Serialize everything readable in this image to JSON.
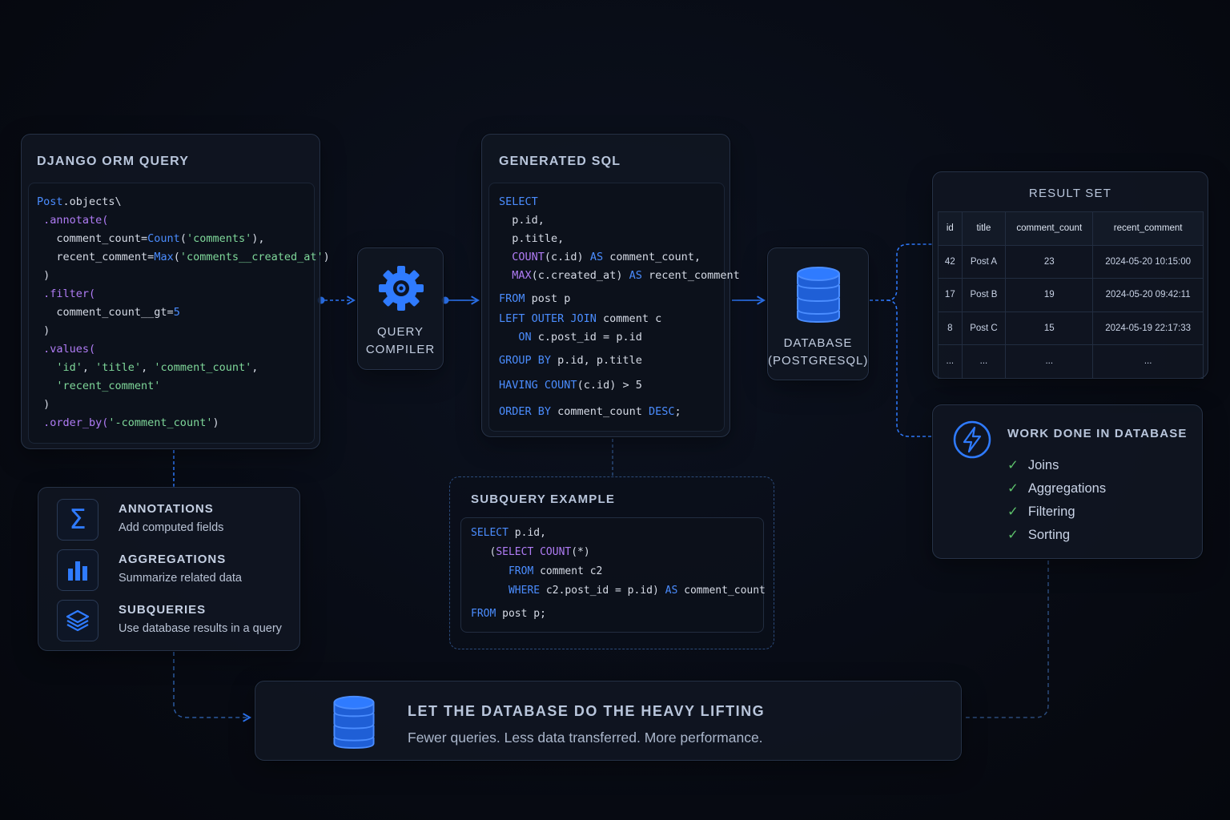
{
  "orm_panel": {
    "title": "DJANGO ORM QUERY",
    "lines": [
      [
        {
          "t": "Post",
          "c": "kw"
        },
        {
          "t": ".objects\\",
          "c": ""
        }
      ],
      [
        {
          "t": " .annotate(",
          "c": "fn"
        }
      ],
      [
        {
          "t": "   comment_count=",
          "c": ""
        },
        {
          "t": "Count",
          "c": "kw"
        },
        {
          "t": "(",
          "c": ""
        },
        {
          "t": "'comments'",
          "c": "str"
        },
        {
          "t": "),",
          "c": ""
        }
      ],
      [
        {
          "t": "   recent_comment=",
          "c": ""
        },
        {
          "t": "Max",
          "c": "kw"
        },
        {
          "t": "(",
          "c": ""
        },
        {
          "t": "'comments__created_at'",
          "c": "str"
        },
        {
          "t": ")",
          "c": ""
        }
      ],
      [
        {
          "t": " )",
          "c": ""
        }
      ],
      [
        {
          "t": " .filter(",
          "c": "fn"
        }
      ],
      [
        {
          "t": "   comment_count__gt=",
          "c": ""
        },
        {
          "t": "5",
          "c": "kw"
        }
      ],
      [
        {
          "t": " )",
          "c": ""
        }
      ],
      [
        {
          "t": " .values(",
          "c": "fn"
        }
      ],
      [
        {
          "t": "   ",
          "c": ""
        },
        {
          "t": "'id'",
          "c": "str"
        },
        {
          "t": ", ",
          "c": ""
        },
        {
          "t": "'title'",
          "c": "str"
        },
        {
          "t": ", ",
          "c": ""
        },
        {
          "t": "'comment_count'",
          "c": "str"
        },
        {
          "t": ",",
          "c": ""
        }
      ],
      [
        {
          "t": "   ",
          "c": ""
        },
        {
          "t": "'recent_comment'",
          "c": "str"
        }
      ],
      [
        {
          "t": " )",
          "c": ""
        }
      ],
      [
        {
          "t": " .order_by(",
          "c": "fn"
        },
        {
          "t": "'-comment_count'",
          "c": "str"
        },
        {
          "t": ")",
          "c": ""
        }
      ]
    ]
  },
  "compiler": {
    "line1": "QUERY",
    "line2": "COMPILER",
    "icon": "gear-icon"
  },
  "sql_panel": {
    "title": "GENERATED SQL",
    "lines": [
      [
        {
          "t": "SELECT",
          "c": "kw"
        }
      ],
      [
        {
          "t": "  p.id,",
          "c": ""
        }
      ],
      [
        {
          "t": "  p.title,",
          "c": ""
        }
      ],
      [
        {
          "t": "  ",
          "c": ""
        },
        {
          "t": "COUNT",
          "c": "fn"
        },
        {
          "t": "(c.id) ",
          "c": ""
        },
        {
          "t": "AS",
          "c": "kw"
        },
        {
          "t": " comment_count,",
          "c": ""
        }
      ],
      [
        {
          "t": "  ",
          "c": ""
        },
        {
          "t": "MAX",
          "c": "fn"
        },
        {
          "t": "(c.created_at) ",
          "c": ""
        },
        {
          "t": "AS",
          "c": "kw"
        },
        {
          "t": " recent_comment",
          "c": ""
        }
      ],
      [
        {
          "t": "FROM",
          "c": "kw"
        },
        {
          "t": " post p",
          "c": ""
        }
      ],
      [
        {
          "t": "LEFT OUTER JOIN",
          "c": "kw"
        },
        {
          "t": " comment c",
          "c": ""
        }
      ],
      [
        {
          "t": "   ",
          "c": ""
        },
        {
          "t": "ON",
          "c": "kw"
        },
        {
          "t": " c.post_id = p.id",
          "c": ""
        }
      ],
      [
        {
          "t": "GROUP BY",
          "c": "kw"
        },
        {
          "t": " p.id, p.title",
          "c": ""
        }
      ],
      [
        {
          "t": "HAVING",
          "c": "kw"
        },
        {
          "t": " ",
          "c": ""
        },
        {
          "t": "COUNT",
          "c": "kw"
        },
        {
          "t": "(c.id) > 5",
          "c": ""
        }
      ],
      [
        {
          "t": "ORDER BY",
          "c": "kw"
        },
        {
          "t": " comment_count ",
          "c": ""
        },
        {
          "t": "DESC",
          "c": "kw"
        },
        {
          "t": ";",
          "c": ""
        }
      ]
    ]
  },
  "database": {
    "line1": "DATABASE",
    "line2": "(POSTGRESQL)",
    "icon": "database-icon"
  },
  "result_set": {
    "title": "RESULT SET",
    "headers": [
      "id",
      "title",
      "comment_count",
      "recent_comment"
    ],
    "rows": [
      [
        "42",
        "Post A",
        "23",
        "2024-05-20 10:15:00"
      ],
      [
        "17",
        "Post B",
        "19",
        "2024-05-20 09:42:11"
      ],
      [
        "8",
        "Post C",
        "15",
        "2024-05-19 22:17:33"
      ],
      [
        "...",
        "...",
        "...",
        "..."
      ]
    ]
  },
  "work_panel": {
    "title": "WORK DONE IN DATABASE",
    "icon": "lightning-icon",
    "items": [
      "Joins",
      "Aggregations",
      "Filtering",
      "Sorting"
    ]
  },
  "features": [
    {
      "icon": "sigma-icon",
      "title": "ANNOTATIONS",
      "desc": "Add computed fields"
    },
    {
      "icon": "bar-chart-icon",
      "title": "AGGREGATIONS",
      "desc": "Summarize related data"
    },
    {
      "icon": "layers-icon",
      "title": "SUBQUERIES",
      "desc": "Use database results in a query"
    }
  ],
  "subquery_panel": {
    "title": "SUBQUERY EXAMPLE",
    "lines": [
      [
        {
          "t": "SELECT",
          "c": "kw"
        },
        {
          "t": " p.id,",
          "c": ""
        }
      ],
      [
        {
          "t": "   (",
          "c": ""
        },
        {
          "t": "SELECT COUNT",
          "c": "fn"
        },
        {
          "t": "(*)",
          "c": ""
        }
      ],
      [
        {
          "t": "      ",
          "c": ""
        },
        {
          "t": "FROM",
          "c": "kw"
        },
        {
          "t": " comment c2",
          "c": ""
        }
      ],
      [
        {
          "t": "      ",
          "c": ""
        },
        {
          "t": "WHERE",
          "c": "kw"
        },
        {
          "t": " c2.post_id = p.id) ",
          "c": ""
        },
        {
          "t": "AS",
          "c": "kw"
        },
        {
          "t": " comment_count",
          "c": ""
        }
      ],
      [
        {
          "t": "FROM",
          "c": "kw"
        },
        {
          "t": " post p;",
          "c": ""
        }
      ]
    ]
  },
  "banner": {
    "title": "LET THE DATABASE DO THE HEAVY LIFTING",
    "subtitle": "Fewer queries. Less data transferred. More performance.",
    "icon": "database-icon"
  },
  "colors": {
    "accent": "#2f7bff",
    "check": "#5cc06a",
    "keyword": "#4b8dff",
    "function": "#b07cf5",
    "string": "#7fd89a"
  }
}
